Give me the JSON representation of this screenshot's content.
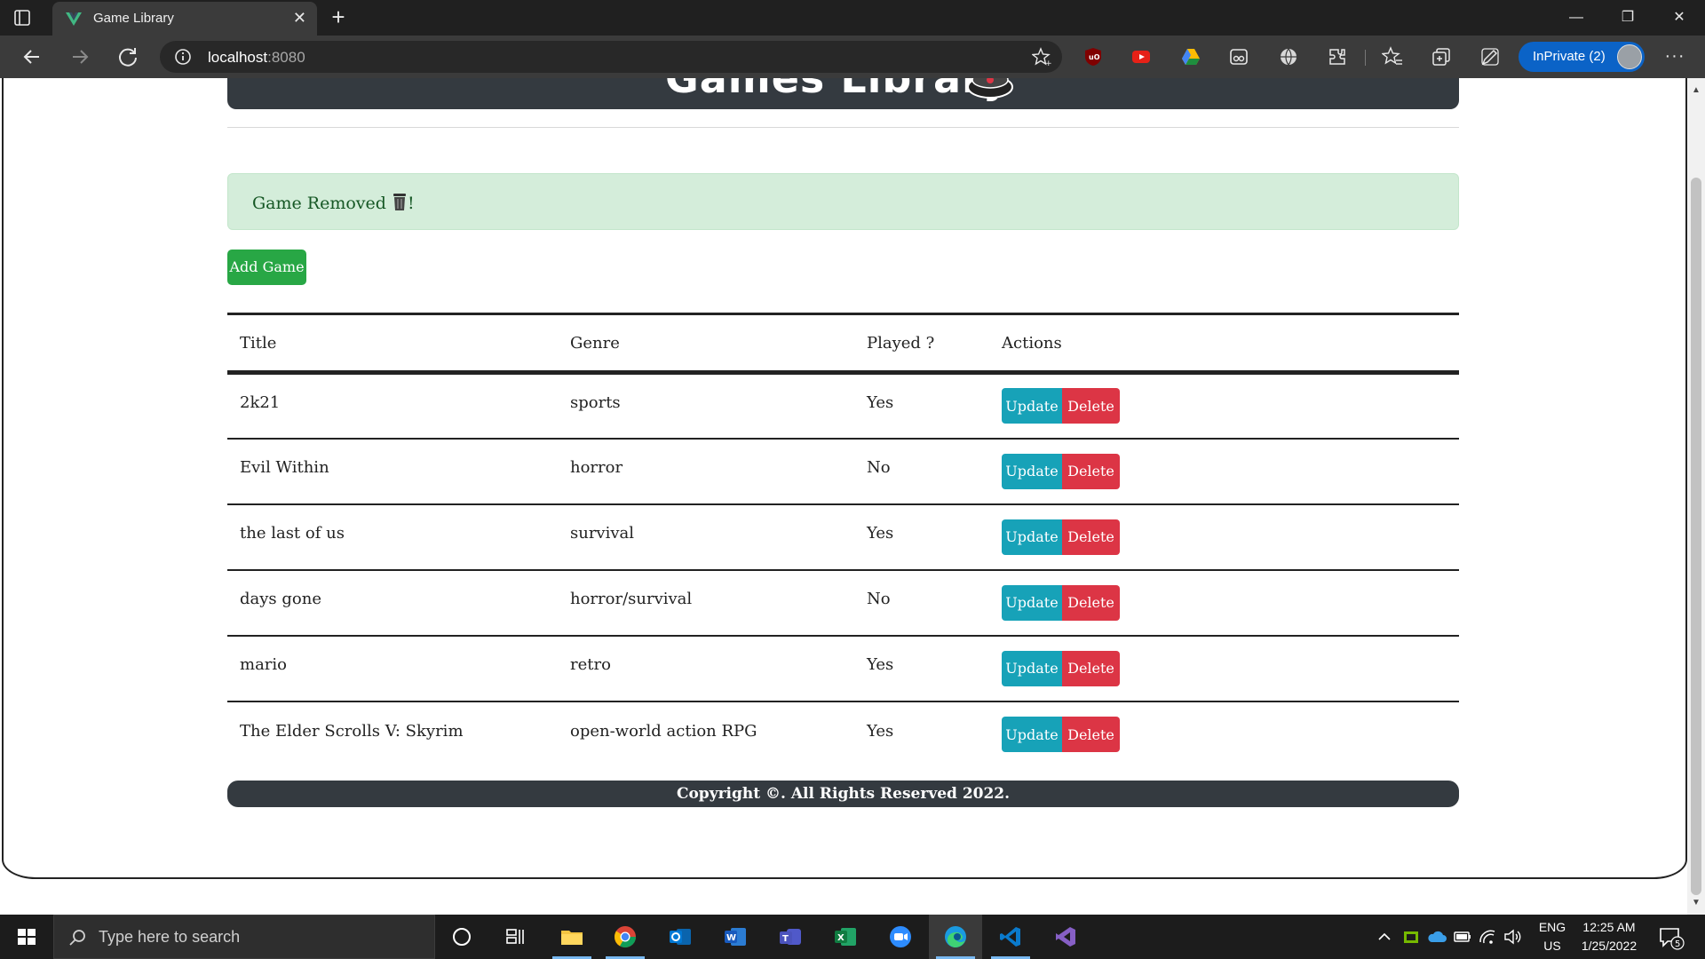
{
  "browser": {
    "tab_title": "Game Library",
    "tab_close": "✕",
    "new_tab": "+",
    "url_host": "localhost",
    "url_port": ":8080",
    "inprivate_label": "InPrivate (2)",
    "more_label": "···",
    "window_controls": {
      "minimize": "—",
      "restore": "❐",
      "close": "✕"
    }
  },
  "page": {
    "header_title": "Games Library",
    "alert_text": "Game Removed",
    "alert_suffix": "!",
    "add_button": "Add Game",
    "table": {
      "headers": [
        "Title",
        "Genre",
        "Played ?",
        "Actions"
      ],
      "rows": [
        {
          "title": "2k21",
          "genre": "sports",
          "played": "Yes"
        },
        {
          "title": "Evil Within",
          "genre": "horror",
          "played": "No"
        },
        {
          "title": "the last of us",
          "genre": "survival",
          "played": "Yes"
        },
        {
          "title": "days gone",
          "genre": "horror/survival",
          "played": "No"
        },
        {
          "title": "mario",
          "genre": "retro",
          "played": "Yes"
        },
        {
          "title": "The Elder Scrolls V: Skyrim",
          "genre": "open-world action RPG",
          "played": "Yes"
        }
      ],
      "update_label": "Update",
      "delete_label": "Delete"
    },
    "footer": "Copyright ©. All Rights Reserved 2022."
  },
  "taskbar": {
    "search_placeholder": "Type here to search",
    "lang_top": "ENG",
    "lang_bottom": "US",
    "time": "12:25 AM",
    "date": "1/25/2022",
    "notification_count": "5"
  },
  "colors": {
    "add_button": "#28a745",
    "update_button": "#17a2b8",
    "delete_button": "#dc3545",
    "alert_bg": "#d4edda",
    "header_bg": "#343a40",
    "inprivate_badge": "#0b63c7"
  }
}
